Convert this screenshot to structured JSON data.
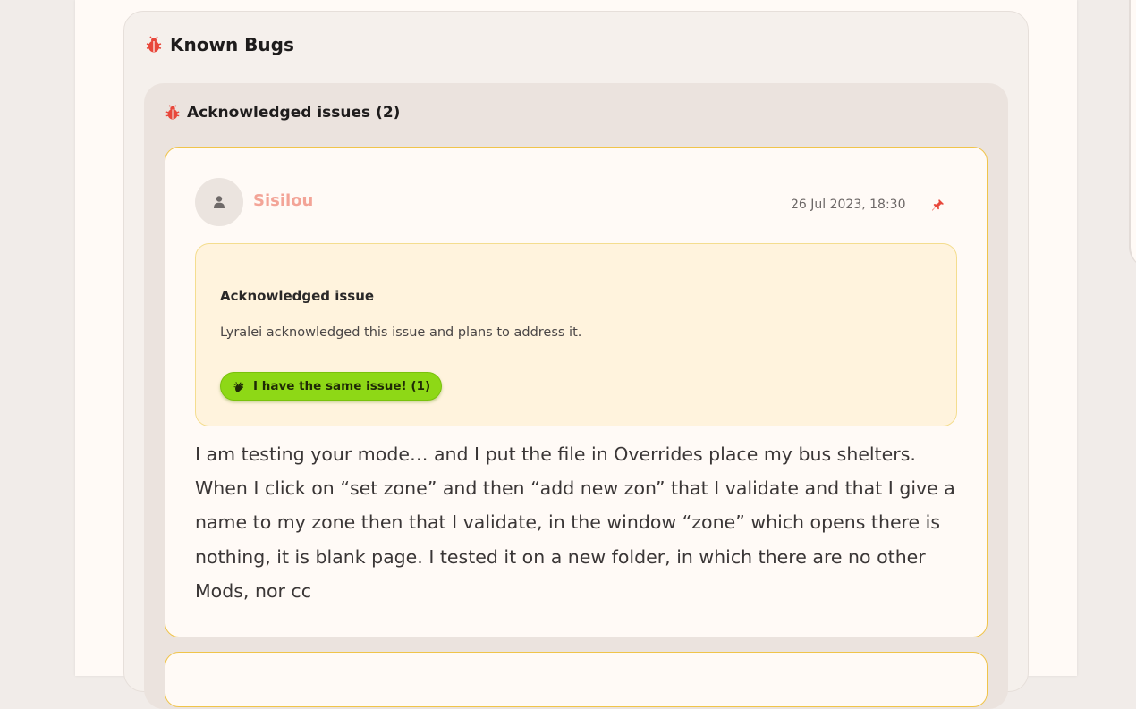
{
  "section": {
    "title": "Known Bugs",
    "icon": "bug-icon"
  },
  "group": {
    "title": "Acknowledged issues (2)",
    "icon": "bug-icon"
  },
  "post": {
    "author": "Sisilou",
    "timestamp": "26 Jul 2023, 18:30",
    "pin_icon": "pin-icon",
    "notice": {
      "title": "Acknowledged issue",
      "text": "Lyralei acknowledged this issue and plans to address it."
    },
    "same_issue_button": {
      "label": "I have the same issue! (1)",
      "icon": "hand-wave-icon"
    },
    "body": "I am testing your mode… and I put the file in Overrides place my bus shelters. When I click on “set zone” and then “add new zon” that I validate and that I give a name to my zone then that I validate, in the window “zone” which opens there is nothing, it is blank page. I tested it on a new folder, in which there are no other Mods, nor cc"
  },
  "colors": {
    "accent_red": "#e8473b",
    "author_link": "#f3a497",
    "card_border": "#f0c44a",
    "notice_bg": "#fff3dd",
    "button_green": "#8ed816"
  }
}
